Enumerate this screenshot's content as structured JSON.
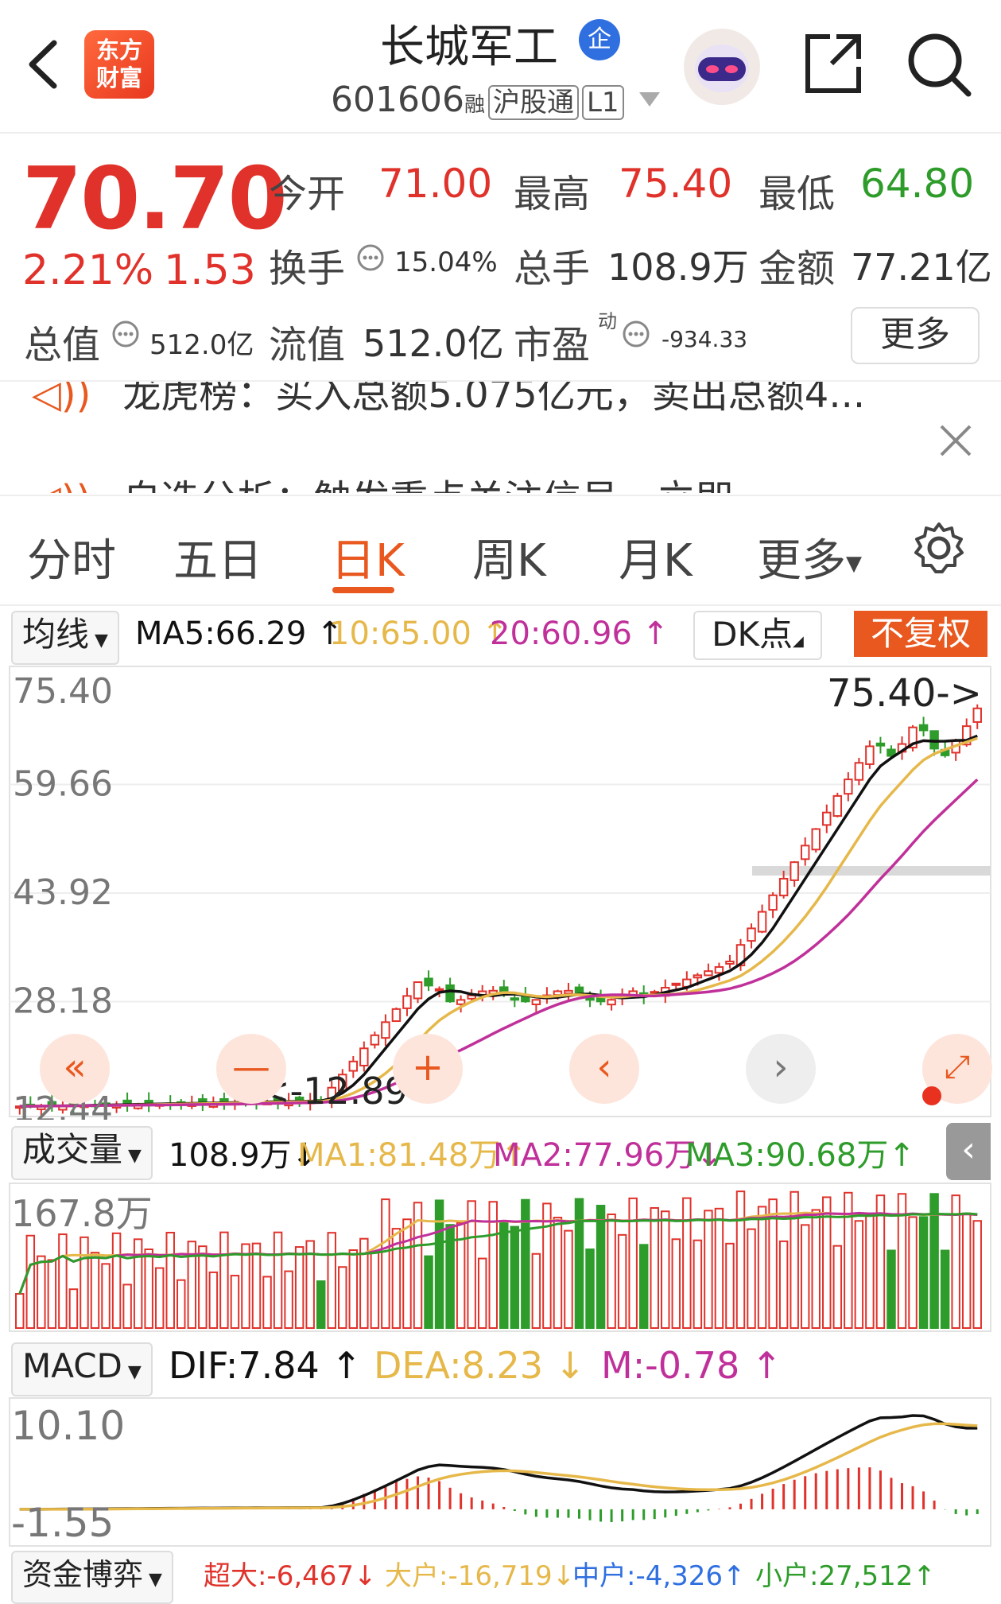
{
  "header": {
    "back_icon": "chevron-left-icon",
    "logo_text_line1": "东方",
    "logo_text_line2": "财富",
    "stock_name": "长城军工",
    "company_badge": "企",
    "stock_code": "601606",
    "tag_rong": "融",
    "tag_hgt": "沪股通",
    "tag_level": "L1",
    "robot_icon": "robot-assistant-icon",
    "share_icon": "share-icon",
    "search_icon": "search-icon"
  },
  "quote": {
    "price": "70.70",
    "change_pct": "2.21%",
    "change_amt": "1.53",
    "open_label": "今开",
    "open": "71.00",
    "high_label": "最高",
    "high": "75.40",
    "low_label": "最低",
    "low": "64.80",
    "turnover_label": "换手",
    "turnover": "15.04%",
    "volume_label": "总手",
    "volume": "108.9万",
    "amount_label": "金额",
    "amount": "77.21亿",
    "mktcap_label": "总值",
    "mktcap": "512.0亿",
    "float_label": "流值",
    "float": "512.0亿",
    "pe_label": "市盈",
    "pe_sup": "动",
    "pe": "-934.33",
    "more_label": "更多"
  },
  "news": {
    "line1": "龙虎榜：买入总额5.075亿元，卖出总额4...",
    "line2": "自选分析：触发重点关注信号，立即",
    "close_icon": "close-icon"
  },
  "period_tabs": [
    "分时",
    "五日",
    "日K",
    "周K",
    "月K",
    "更多"
  ],
  "active_tab": "日K",
  "settings_icon": "gear-icon",
  "kline": {
    "selector": "均线",
    "ma5": "MA5:66.29",
    "ma10": "10:65.00",
    "ma20": "20:60.96",
    "dk_label": "DK点",
    "fq_label": "不复权",
    "y_labels": [
      "75.40",
      "59.66",
      "43.92",
      "28.18",
      "12.44"
    ],
    "max_marker": "75.40->",
    "min_marker": "<-12.89",
    "colors": {
      "up": "#e0322b",
      "down": "#2e9c2a",
      "ma5": "#111111",
      "ma10": "#e6b84a",
      "ma20": "#c0309a"
    }
  },
  "volume": {
    "selector": "成交量",
    "current": "108.9万",
    "ma1": "MA1:81.48万",
    "ma2": "MA2:77.96万",
    "ma3": "MA3:90.68万",
    "y_label": "167.8万"
  },
  "macd": {
    "selector": "MACD",
    "dif": "DIF:7.84",
    "dea": "DEA:8.23",
    "m": "M:-0.78",
    "y_top": "10.10",
    "y_bottom": "-1.55"
  },
  "capital": {
    "selector": "资金博弈",
    "super": "超大:-6,467",
    "large": "大户:-16,719",
    "medium": "中户:-4,326",
    "small": "小户:27,512"
  },
  "chart_data": {
    "type": "candlestick",
    "title": "",
    "ylim": [
      12.44,
      75.4
    ],
    "ma_latest": {
      "MA5": 66.29,
      "MA10": 65.0,
      "MA20": 60.96
    },
    "last": {
      "open": 71.0,
      "high": 75.4,
      "low": 64.8,
      "close": 70.7
    },
    "period_low": 12.89,
    "volume_max": "167.8万",
    "macd_range": [
      -1.55,
      10.1
    ]
  }
}
